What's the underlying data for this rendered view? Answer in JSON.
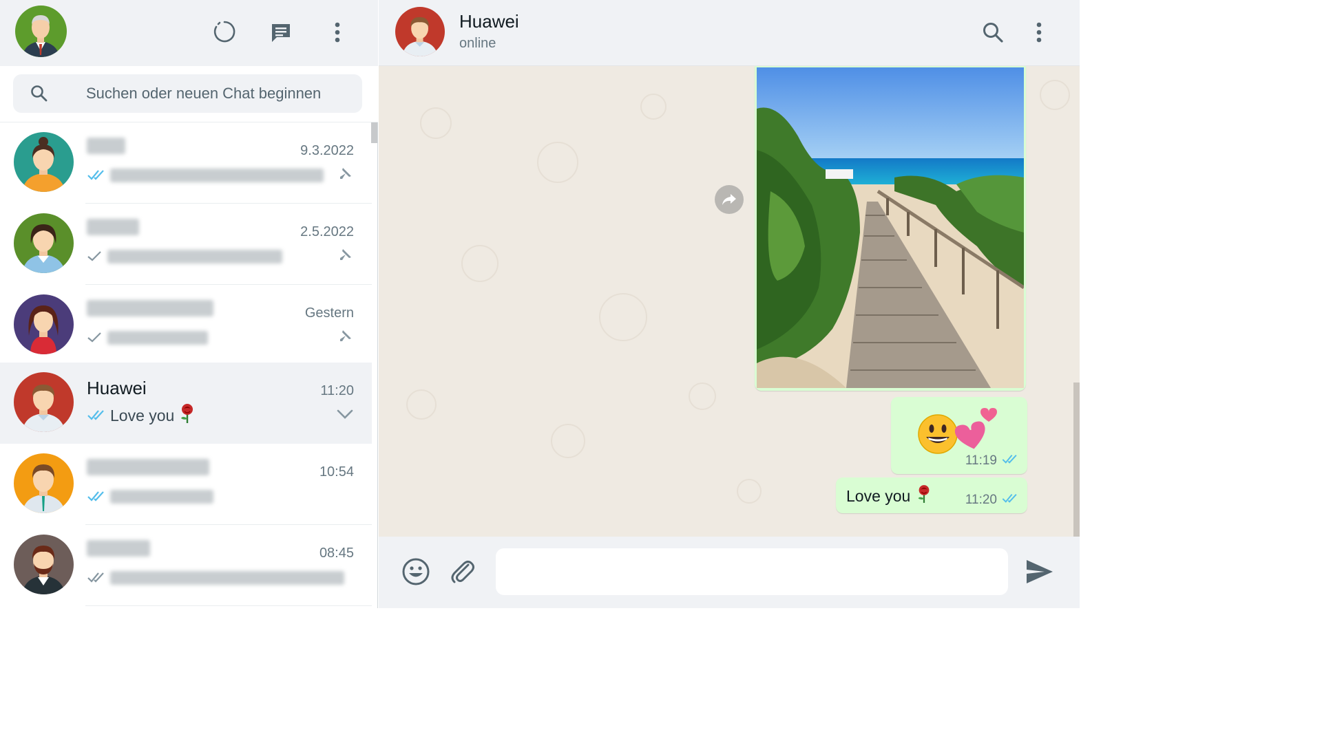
{
  "sidebar": {
    "header": {
      "my_avatar": "user-avatar",
      "icons": [
        "status-icon",
        "new-chat-icon",
        "menu-icon"
      ]
    },
    "search": {
      "placeholder": "Suchen oder neuen Chat beginnen"
    },
    "chats": [
      {
        "name": "",
        "time": "9.3.2022",
        "tick": "double-blue",
        "preview": "",
        "aside": "pin-icon",
        "avatar_colors": {
          "bg": "#2a9d8f",
          "shirt": "#f4a02d",
          "hair": "#4a2e22"
        }
      },
      {
        "name": "",
        "time": "2.5.2022",
        "tick": "single-grey",
        "preview": "",
        "aside": "pin-icon",
        "avatar_colors": {
          "bg": "#5a8f2a",
          "shirt": "#8fc3e6",
          "hair": "#3a2418"
        }
      },
      {
        "name": "",
        "time": "Gestern",
        "tick": "single-grey",
        "preview": "",
        "aside": "pin-icon",
        "avatar_colors": {
          "bg": "#4b3c7a",
          "shirt": "#d92b36",
          "hair": "#5a2318"
        }
      },
      {
        "name": "Huawei",
        "time": "11:20",
        "tick": "double-blue",
        "preview": "Love you",
        "preview_emoji": "rose-emoji",
        "aside": "chevron-down-icon",
        "active": true,
        "avatar_colors": {
          "bg": "#c0392b",
          "shirt": "#e8eef3",
          "hair": "#8a5a34"
        }
      },
      {
        "name": "",
        "time": "10:54",
        "tick": "double-blue",
        "preview": "",
        "aside": "",
        "avatar_colors": {
          "bg": "#f39c12",
          "shirt": "#dfe7ee",
          "hair": "#7a4a26"
        }
      },
      {
        "name": "",
        "time": "08:45",
        "tick": "double-grey",
        "preview": "",
        "aside": "",
        "avatar_colors": {
          "bg": "#6d5d59",
          "shirt": "#ffffff",
          "hair": "#6a2a18"
        }
      }
    ]
  },
  "conversation": {
    "contact_name": "Huawei",
    "contact_status": "online",
    "header_icons": [
      "search-icon",
      "menu-icon"
    ],
    "messages": [
      {
        "type": "image",
        "subject": "beach boardwalk photo",
        "forward_icon": "forward-icon"
      },
      {
        "type": "emoji",
        "content": [
          "grinning-face-emoji",
          "two-hearts-emoji"
        ],
        "time": "11:19",
        "tick": "double-blue"
      },
      {
        "type": "text",
        "text": "Love you",
        "emoji": "rose-emoji",
        "time": "11:20",
        "tick": "double-blue"
      }
    ],
    "composer": {
      "value": "",
      "placeholder": "",
      "icons": [
        "emoji-icon",
        "attach-icon",
        "send-icon"
      ]
    }
  },
  "colors": {
    "header_bg": "#f0f2f5",
    "chat_bg": "#efeae2",
    "outgoing_bubble": "#d9fdd3",
    "tick_blue": "#53bdeb",
    "icon_grey": "#54656f"
  }
}
